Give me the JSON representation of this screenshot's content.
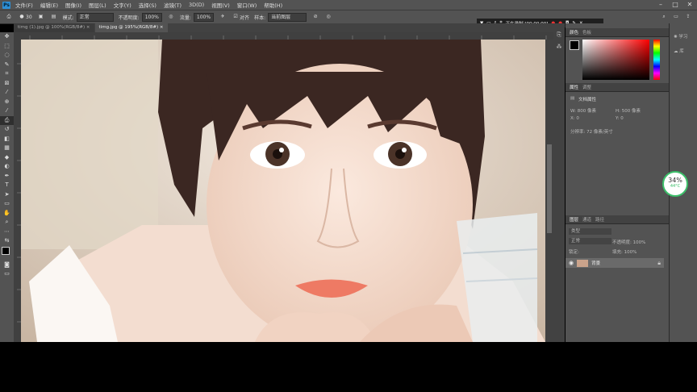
{
  "menubar": {
    "logo": "Ps",
    "items": [
      "文件(F)",
      "编辑(E)",
      "图像(I)",
      "图层(L)",
      "文字(Y)",
      "选择(S)",
      "滤镜(T)",
      "3D(D)",
      "视图(V)",
      "窗口(W)",
      "帮助(H)"
    ],
    "minimize": "–",
    "maximize": "□",
    "close": "✕"
  },
  "options": {
    "brush_size": "30",
    "mode_label": "模式:",
    "mode_value": "正常",
    "opacity_label": "不透明度:",
    "opacity_value": "100%",
    "flow_label": "流量:",
    "flow_value": "100%",
    "align_label": "对齐",
    "sample_label": "样本:",
    "sample_value": "当前图层"
  },
  "tabs": [
    {
      "label": "timg (1).jpg @ 100%(RGB/8#)",
      "close": "×"
    },
    {
      "label": "timg.jpg @ 195%(RGB/8#)",
      "close": "×"
    }
  ],
  "recorder": {
    "status": "正在录制 [00:00:00]"
  },
  "panels": {
    "color_tabs": [
      "颜色",
      "色板"
    ],
    "properties_tabs": [
      "属性",
      "调整"
    ],
    "doc_props": "文档属性",
    "w_label": "W:",
    "w_value": "800 像素",
    "h_label": "H:",
    "h_value": "500 像素",
    "x_label": "X:",
    "x_value": "0",
    "y_label": "Y:",
    "y_value": "0",
    "resolution": "分辨率: 72 像素/英寸",
    "layers_tabs": [
      "图层",
      "通道",
      "路径"
    ],
    "kind": "类型",
    "blend": "正常",
    "opacity_label": "不透明度:",
    "opacity_value": "100%",
    "lock_label": "锁定:",
    "fill_label": "填充:",
    "fill_value": "100%",
    "layer_name": "背景"
  },
  "farright": {
    "learn": "学习",
    "library": "库"
  },
  "badge": {
    "percent": "34%",
    "temp": "44°C"
  },
  "colors": {
    "accent": "#2d8fd6",
    "foreground": "#000000",
    "background": "#d9202f",
    "badge_ring": "#3cbf6a"
  }
}
